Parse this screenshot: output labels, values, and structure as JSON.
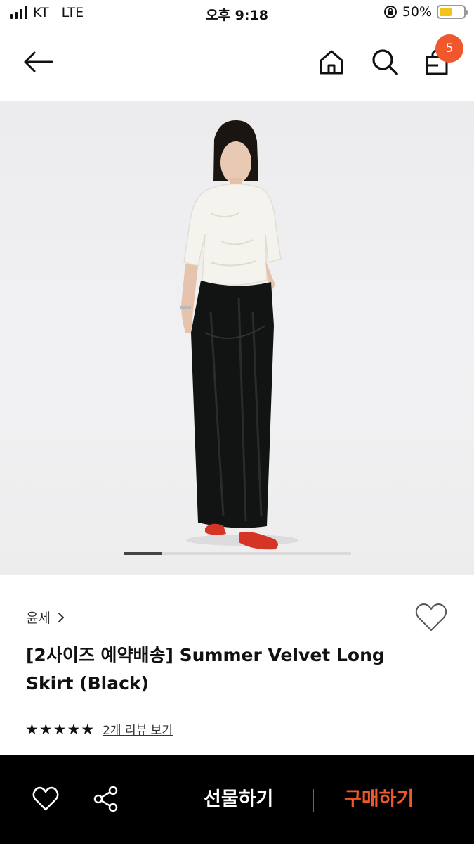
{
  "status_bar": {
    "carrier": "KT",
    "network": "LTE",
    "time": "오후 9:18",
    "battery_percent": "50%",
    "battery_level": 0.5
  },
  "nav": {
    "back_icon": "arrow-left-icon",
    "home_icon": "home-icon",
    "search_icon": "search-icon",
    "cart_icon": "shopping-bag-icon",
    "cart_count": "5"
  },
  "product": {
    "brand": "윤세",
    "title": "[2사이즈 예약배송] Summer Velvet Long Skirt (Black)",
    "rating": 5,
    "stars": [
      "★",
      "★",
      "★",
      "★",
      "★"
    ],
    "review_link": "2개 리뷰 보기",
    "image_count_active": 1
  },
  "bottom_bar": {
    "gift_label": "선물하기",
    "buy_label": "구매하기"
  },
  "colors": {
    "accent": "#f0572c",
    "bottom_bar": "#000000"
  }
}
